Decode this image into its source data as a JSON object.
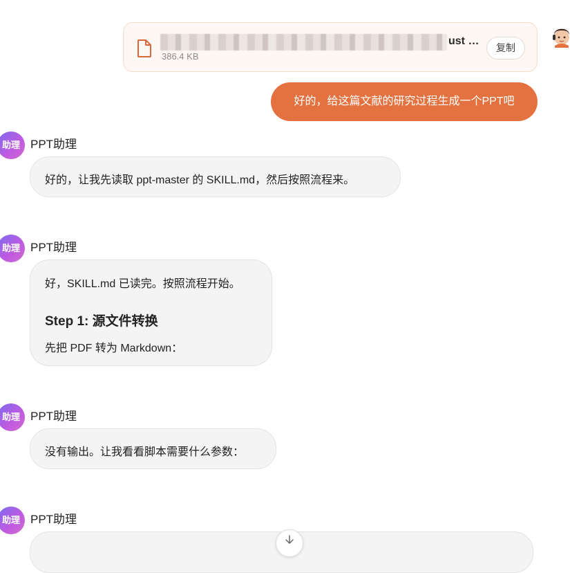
{
  "user_message": {
    "file": {
      "name_visible_suffix": "ust …",
      "size": "386.4 KB",
      "copy_label": "复制",
      "icon": "file-icon"
    },
    "text": "好的，给这篇文献的研究过程生成一个PPT吧"
  },
  "messages": [
    {
      "avatar_text": "助理",
      "sender": "PPT助理",
      "lines": [
        "好的，让我先读取 ppt-master 的 SKILL.md，然后按照流程来。"
      ]
    },
    {
      "avatar_text": "助理",
      "sender": "PPT助理",
      "intro": "好，SKILL.md 已读完。按照流程开始。",
      "heading": "Step 1: 源文件转换",
      "body": "先把 PDF 转为 Markdown："
    },
    {
      "avatar_text": "助理",
      "sender": "PPT助理",
      "lines": [
        "没有输出。让我看看脚本需要什么参数："
      ]
    },
    {
      "avatar_text": "助理",
      "sender": "PPT助理"
    }
  ],
  "scroll_button_icon": "arrow-down-icon",
  "colors": {
    "user_bubble": "#e37240",
    "file_card_bg": "#fff7f3",
    "avatar_gradient": [
      "#7c6cf0",
      "#d06bd0"
    ],
    "bot_bubble": "#f4f4f4"
  }
}
